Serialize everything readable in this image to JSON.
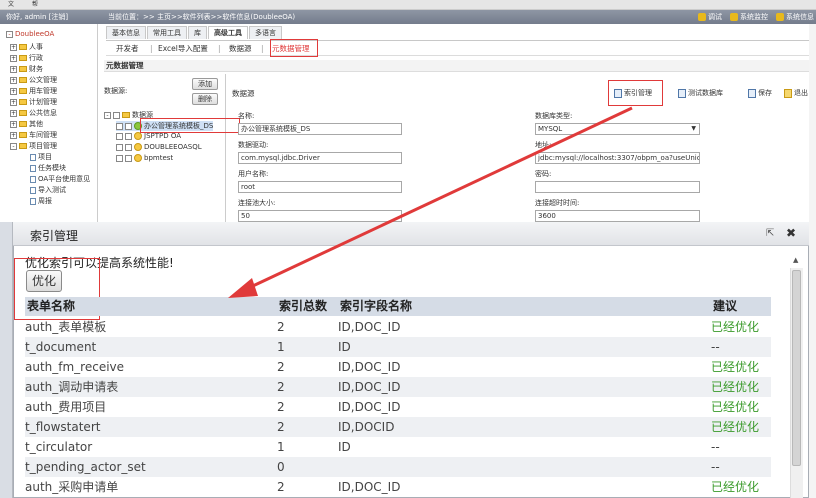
{
  "topbar": {
    "items": [
      "文",
      "帮"
    ]
  },
  "infobar": {
    "user": "你好, admin [注销]",
    "location": "当前位置：>> 主页>>软件列表>>软件信息(DoubleeOA)",
    "tools": [
      "调试",
      "系统监控",
      "系统信息"
    ]
  },
  "tree": {
    "root": "DoubleeOA",
    "items": [
      "人事",
      "行政",
      "财务",
      "公文管理",
      "用车管理",
      "计划管理",
      "公共信息",
      "其他",
      "车间管理",
      "项目管理"
    ],
    "subitems": [
      "项目",
      "任务模块",
      "OA平台使用意见",
      "导入测试",
      "周报"
    ]
  },
  "tabs": [
    "基本信息",
    "常用工具",
    "库",
    "高级工具",
    "多语言"
  ],
  "subtabs": [
    "开发者",
    "Excel导入配置",
    "数据源",
    "元数据管理"
  ],
  "section_title": "元数据管理",
  "ds": {
    "label": "数据源:",
    "add": "添加",
    "delete": "删除",
    "tree_root": "数据源",
    "tree_items": [
      "办公管理系统模板_DS",
      "JSPTPD OA",
      "DOUBLEEOASQL",
      "bpmtest"
    ]
  },
  "form": {
    "header": "数据源",
    "name_label": "名称:",
    "name": "办公管理系统模板_DS",
    "dbtype_label": "数据库类型:",
    "dbtype": "MYSQL",
    "driver_label": "数据驱动:",
    "driver": "com.mysql.jdbc.Driver",
    "url_label": "地址:",
    "url": "jdbc:mysql://localhost:3307/obpm_oa?useUnic",
    "user_label": "用户名称:",
    "user": "root",
    "pwd_label": "密码:",
    "pool_label": "连接池大小:",
    "pool": "50",
    "timeout_label": "连接超时时间:",
    "timeout": "3600"
  },
  "toolbar": {
    "index_mgmt": "索引管理",
    "test_db": "测试数据库",
    "save": "保存",
    "exit": "退出"
  },
  "dialog": {
    "title": "索引管理",
    "tip": "优化索引可以提高系统性能!",
    "optimize": "优化",
    "columns": {
      "name": "表单名称",
      "count": "索引总数",
      "fields": "索引字段名称",
      "advice": "建议"
    },
    "rows": [
      {
        "name": "auth_表单模板",
        "count": "2",
        "fields": "ID,DOC_ID",
        "advice": "已经优化"
      },
      {
        "name": "t_document",
        "count": "1",
        "fields": "ID",
        "advice": "--"
      },
      {
        "name": "auth_fm_receive",
        "count": "2",
        "fields": "ID,DOC_ID",
        "advice": "已经优化"
      },
      {
        "name": "auth_调动申请表",
        "count": "2",
        "fields": "ID,DOC_ID",
        "advice": "已经优化"
      },
      {
        "name": "auth_费用项目",
        "count": "2",
        "fields": "ID,DOC_ID",
        "advice": "已经优化"
      },
      {
        "name": "t_flowstatert",
        "count": "2",
        "fields": "ID,DOCID",
        "advice": "已经优化"
      },
      {
        "name": "t_circulator",
        "count": "1",
        "fields": "ID",
        "advice": "--"
      },
      {
        "name": "t_pending_actor_set",
        "count": "0",
        "fields": "",
        "advice": "--"
      },
      {
        "name": "auth_采购申请单",
        "count": "2",
        "fields": "ID,DOC_ID",
        "advice": "已经优化"
      }
    ]
  },
  "colors": {
    "accent_red": "#e03a3a",
    "advice_ok": "#3a9a2a",
    "header_bg": "#d5dce6"
  }
}
